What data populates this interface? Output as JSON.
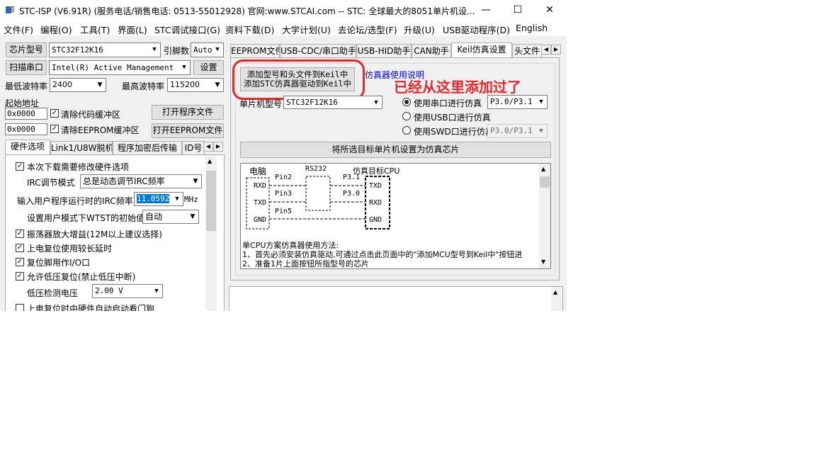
{
  "window": {
    "title": "STC-ISP (V6.91R) (服务电话/销售电话: 0513-55012928) 官网:www.STCAI.com  -- STC: 全球最大的8051单片机设...",
    "controls": {
      "minimize": "—",
      "maximize": "☐",
      "close": "✕"
    }
  },
  "menu": [
    "文件(F)",
    "编程(O)",
    "工具(T)",
    "界面(L)",
    "STC调试接口(G)",
    "资料下载(D)",
    "大学计划(U)",
    "去论坛/选型(F)",
    "升级(U)",
    "USB驱动程序(D)",
    "English"
  ],
  "left": {
    "chip_label": "芯片型号",
    "chip_value": "STC32F12K16",
    "pin_label": "引脚数",
    "pin_value": "Auto",
    "scan_button": "扫描串口",
    "port_value": "Intel(R) Active Management Te",
    "settings_button": "设置",
    "min_baud_label": "最低波特率",
    "min_baud_value": "2400",
    "max_baud_label": "最高波特率",
    "max_baud_value": "115200",
    "start_addr_label": "起始地址",
    "addr1": "0x0000",
    "clear_code": "清除代码缓冲区",
    "open_prog": "打开程序文件",
    "addr2": "0x0000",
    "clear_eeprom": "清除EEPROM缓冲区",
    "open_eeprom": "打开EEPROM文件",
    "tabs": [
      "硬件选项",
      "Link1/U8W脱机",
      "程序加密后传输",
      "ID号"
    ],
    "options": {
      "opt1": "本次下载需要修改硬件选项",
      "irc_mode_label": "IRC调节模式",
      "irc_mode_value": "总是动态调节IRC频率",
      "freq_label": "输入用户程序运行时的IRC频率",
      "freq_value": "11.0592",
      "freq_unit": "MHz",
      "wdt_label": "设置用户模式下WTST的初始值",
      "wdt_value": "自动",
      "opt2": "振荡器放大增益(12M以上建议选择)",
      "opt3": "上电复位使用较长延时",
      "opt4": "复位脚用作I/O口",
      "opt5": "允许低压复位(禁止低压中断)",
      "lvd_label": "低压检测电压",
      "lvd_value": "2.00 V",
      "opt6": "上电复位时由硬件自动启动看门狗"
    }
  },
  "right": {
    "tabs": [
      "EEPROM文件",
      "USB-CDC/串口助手",
      "USB-HID助手",
      "CAN助手",
      "Keil仿真设置",
      "头文件"
    ],
    "add_keil_line1": "添加型号和头文件到Keil中",
    "add_keil_line2": "添加STC仿真器驱动到Keil中",
    "manual_link": "仿真器使用说明",
    "annotation": "已经从这里添加过了",
    "mcu_label": "单片机型号",
    "mcu_value": "STC32F12K16",
    "radio_serial": "使用串口进行仿真",
    "radio_usb": "使用USB口进行仿真",
    "radio_swd": "使用SWD口进行仿真",
    "serial_port_value": "P3.0/P3.1",
    "swd_port_value": "P3.0/P3.1",
    "set_emulator_button": "将所选目标单片机设置为仿真芯片",
    "diagram": {
      "pc": "电脑",
      "rs232": "RS232",
      "target": "仿真目标CPU",
      "rxd": "RXD",
      "txd": "TXD",
      "gnd": "GND",
      "pin2": "Pin2",
      "pin3": "Pin3",
      "pin5": "Pin5",
      "p31": "P3.1",
      "p30": "P3.0"
    },
    "notes": [
      "单CPU方案仿真器使用方法:",
      "1、首先必须安装仿真驱动,可通过点击此页面中的\"添加MCU型号到Keil中\"按钮进",
      "2、准备1片上面按钮所指型号的芯片"
    ]
  },
  "colors": {
    "annotation": "#e8262b",
    "highlight_ring": "#e8262b",
    "link": "#0000ee",
    "selection": "#0078d7"
  }
}
